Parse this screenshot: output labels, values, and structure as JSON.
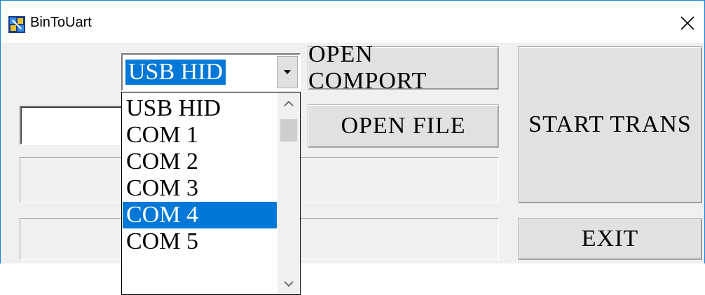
{
  "window": {
    "title": "BinToUart",
    "app_icon": "bin-to-uart-app-icon",
    "close_icon": "close-icon"
  },
  "port_select": {
    "selected": "USB HID",
    "options": [
      "USB HID",
      "COM 1",
      "COM 2",
      "COM 3",
      "COM 4",
      "COM 5"
    ],
    "highlighted": "COM 4"
  },
  "buttons": {
    "open_comport": "OPEN COMPORT",
    "open_file": "OPEN FILE",
    "start_trans": "START TRANS",
    "exit": "EXIT"
  },
  "file_path": {
    "value": ""
  },
  "colors": {
    "selection": "#0078d7",
    "window_border": "#1883d7",
    "client_bg": "#f0f0f0",
    "button_bg": "#e1e1e1"
  }
}
